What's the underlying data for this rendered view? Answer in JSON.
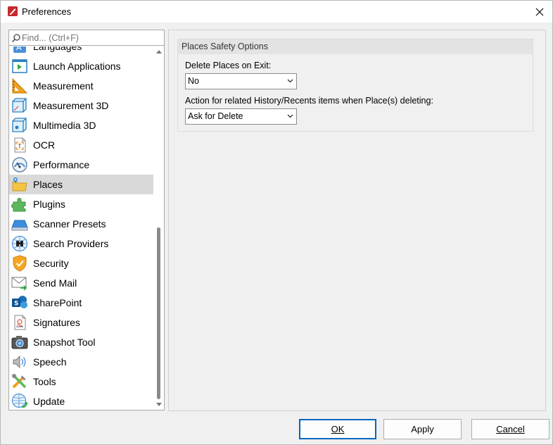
{
  "window": {
    "title": "Preferences"
  },
  "search": {
    "placeholder": "Find... (Ctrl+F)"
  },
  "sidebar": {
    "items": [
      {
        "label": "Languages",
        "icon": "languages-icon"
      },
      {
        "label": "Launch Applications",
        "icon": "launch-applications-icon"
      },
      {
        "label": "Measurement",
        "icon": "ruler-icon"
      },
      {
        "label": "Measurement 3D",
        "icon": "cube-3d-icon"
      },
      {
        "label": "Multimedia 3D",
        "icon": "cube-multimedia-icon"
      },
      {
        "label": "OCR",
        "icon": "ocr-icon"
      },
      {
        "label": "Performance",
        "icon": "gauge-icon"
      },
      {
        "label": "Places",
        "icon": "folder-pin-icon",
        "selected": true
      },
      {
        "label": "Plugins",
        "icon": "puzzle-icon"
      },
      {
        "label": "Scanner Presets",
        "icon": "scanner-icon"
      },
      {
        "label": "Search Providers",
        "icon": "binoculars-icon"
      },
      {
        "label": "Security",
        "icon": "shield-icon"
      },
      {
        "label": "Send Mail",
        "icon": "envelope-icon"
      },
      {
        "label": "SharePoint",
        "icon": "sharepoint-icon"
      },
      {
        "label": "Signatures",
        "icon": "signature-icon"
      },
      {
        "label": "Snapshot Tool",
        "icon": "camera-icon"
      },
      {
        "label": "Speech",
        "icon": "speaker-icon"
      },
      {
        "label": "Tools",
        "icon": "tools-icon"
      },
      {
        "label": "Update",
        "icon": "globe-update-icon"
      }
    ]
  },
  "content": {
    "group_title": "Places Safety Options",
    "delete_label": "Delete Places on Exit:",
    "delete_value": "No",
    "action_label": "Action for related History/Recents items when Place(s) deleting:",
    "action_value": "Ask for Delete"
  },
  "buttons": {
    "ok": "OK",
    "apply": "Apply",
    "cancel": "Cancel"
  },
  "colors": {
    "accent": "#0067c0",
    "selected_bg": "#d9d9d9"
  }
}
